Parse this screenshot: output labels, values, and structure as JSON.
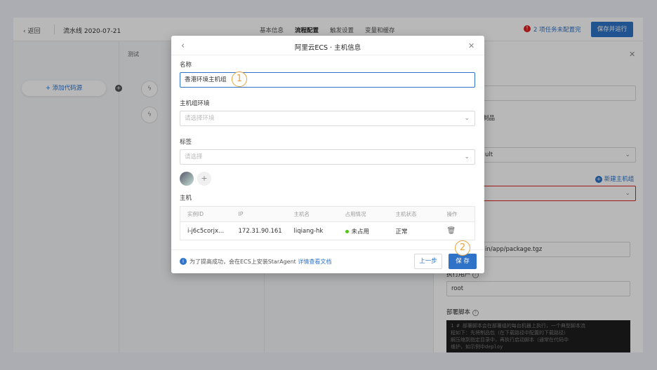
{
  "topbar": {
    "back_label": "返回",
    "pipeline_name": "流水线 2020-07-21",
    "tabs": [
      "基本信息",
      "流程配置",
      "触发设置",
      "变量和缓存"
    ],
    "warning_text": "2 项任务未配置完",
    "save_run_label": "保存并运行"
  },
  "canvas": {
    "stage_label": "测试",
    "add_source_label": "添加代码源"
  },
  "right_panel": {
    "artifact_partial": "制品",
    "env_partial": "ult",
    "new_host_group_label": "新建主机组",
    "path_partial": "in/app/package.tgz",
    "exec_user_label": "执行用户",
    "exec_user_value": "root",
    "deploy_script_label": "部署脚本",
    "code_lines": [
      "1  # 部署脚本会在部署组的每台机器上执行，一个典型脚本流",
      "   程如下：先将制品包（在下载路径中配置的下载路径）",
      "   解压缩到指定目录中，再执行启动脚本（通常在代码中",
      "   维护，如示例中deploy"
    ]
  },
  "modal": {
    "title": "阿里云ECS · 主机信息",
    "name_label": "名称",
    "name_value": "香港环境主机组",
    "env_label": "主机组环境",
    "env_placeholder": "请选择环境",
    "tag_label": "标签",
    "tag_placeholder": "请选择",
    "host_label": "主机",
    "table": {
      "headers": [
        "实例ID",
        "IP",
        "主机名",
        "占用情况",
        "主机状态",
        "操作"
      ],
      "rows": [
        {
          "id": "i-j6c5corjx...",
          "ip": "172.31.90.161",
          "hostname": "liqiang-hk",
          "usage": "未占用",
          "status": "正常"
        }
      ]
    },
    "footer_info": "为了提高成功，会在ECS上安装StarAgent",
    "footer_link": "详情查看文档",
    "prev_label": "上一步",
    "save_label": "保 存"
  },
  "callouts": [
    "1",
    "2"
  ],
  "colors": {
    "primary": "#2f73c9",
    "warning": "#e02020",
    "callout": "#e8a33d",
    "online": "#52c41a"
  }
}
